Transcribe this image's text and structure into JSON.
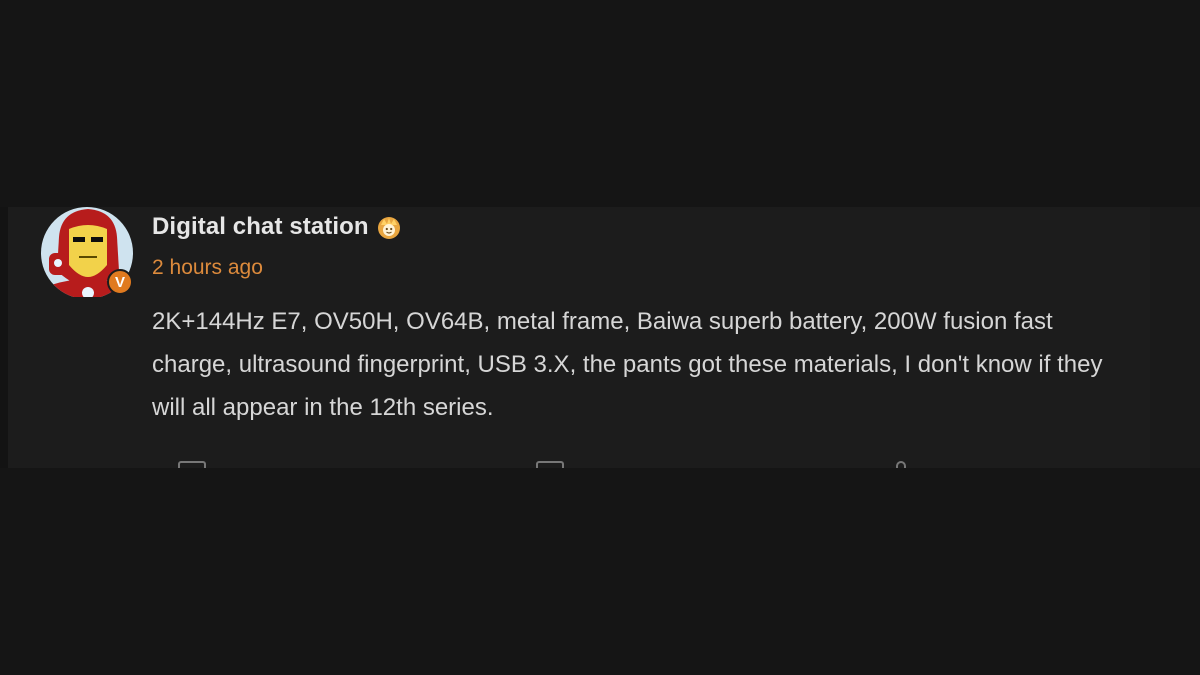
{
  "post": {
    "author": "Digital chat station",
    "timestamp": "2 hours ago",
    "body": "2K+144Hz E7, OV50H, OV64B, metal frame, Baiwa superb battery, 200W fusion fast charge, ultrasound fingerprint, USB 3.X, the pants got these materials, I don't know if they will all appear in the 12th series.",
    "avatar_icon": "iron-man-avatar-icon",
    "verified_badge_icon": "verified-v-badge-icon",
    "verified_badge_letter": "V",
    "rank_badge_icon": "crown-badge-icon"
  },
  "actions": [
    {
      "name": "repost",
      "icon": "repost-icon"
    },
    {
      "name": "comment",
      "icon": "comment-icon"
    },
    {
      "name": "like",
      "icon": "like-icon"
    }
  ],
  "colors": {
    "background": "#151515",
    "card": "#1c1c1c",
    "author_text": "#e6e6e6",
    "timestamp": "#dc8a3c",
    "body_text": "#d6d6d6",
    "badge_orange": "#e07a1f"
  }
}
